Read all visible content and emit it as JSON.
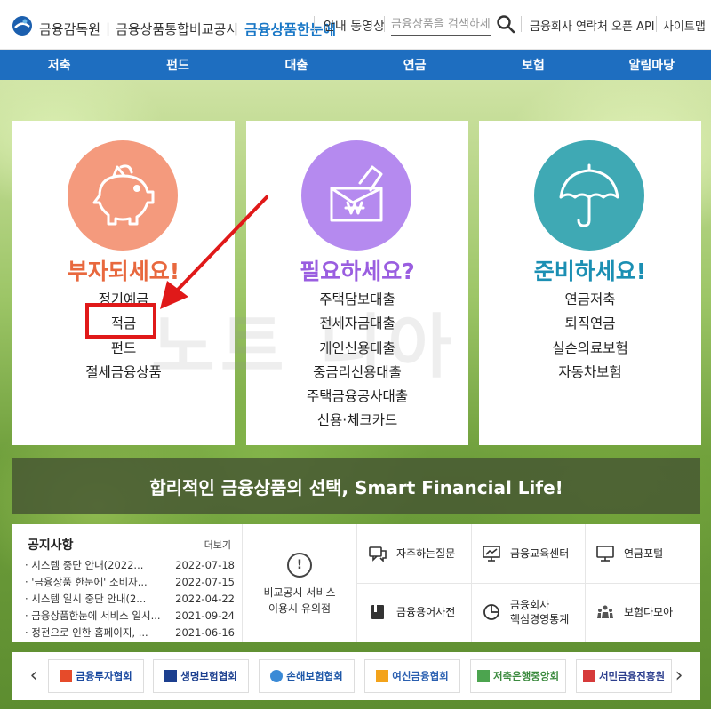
{
  "header": {
    "org": "금융감독원",
    "service": "금융상품통합비교공시",
    "brand": "금융상품한눈에",
    "video_link": "안내 동영상",
    "search_placeholder": "금융상품을 검색하세요",
    "links": [
      "금융회사 연락처",
      "오픈 API",
      "사이트맵"
    ]
  },
  "nav": [
    "저축",
    "펀드",
    "대출",
    "연금",
    "보험",
    "알림마당"
  ],
  "cards": [
    {
      "title": "부자되세요!",
      "color": "#e8683e",
      "circle_color": "#f49a7d",
      "icon": "piggy-bank-icon",
      "items": [
        "정기예금",
        "적금",
        "펀드",
        "절세금융상품"
      ]
    },
    {
      "title": "필요하세요?",
      "color": "#9a5ee0",
      "circle_color": "#b58aef",
      "icon": "won-envelope-icon",
      "items": [
        "주택담보대출",
        "전세자금대출",
        "개인신용대출",
        "중금리신용대출",
        "주택금융공사대출",
        "신용·체크카드"
      ]
    },
    {
      "title": "준비하세요!",
      "color": "#1b8fb3",
      "circle_color": "#3fa9b4",
      "icon": "umbrella-icon",
      "items": [
        "연금저축",
        "퇴직연금",
        "실손의료보험",
        "자동차보험"
      ]
    }
  ],
  "watermark": "노트 니아",
  "banner": "합리적인 금융상품의 선택, Smart Financial Life!",
  "notice": {
    "title": "공지사항",
    "more": "더보기",
    "items": [
      {
        "text": "· 시스템 중단 안내(2022...",
        "date": "2022-07-18"
      },
      {
        "text": "· '금융상품 한눈에' 소비자...",
        "date": "2022-07-15"
      },
      {
        "text": "· 시스템 일시 중단 안내(2...",
        "date": "2022-04-22"
      },
      {
        "text": "· 금융상품한눈에 서비스 일시...",
        "date": "2021-09-24"
      },
      {
        "text": "· 정전으로 인한 홈페이지, ...",
        "date": "2021-06-16"
      }
    ]
  },
  "caution": {
    "line1": "비교공시 서비스",
    "line2": "이용시 유의점"
  },
  "quick_links": [
    {
      "label": "자주하는질문",
      "icon": "chat-icon"
    },
    {
      "label": "금융교육센터",
      "icon": "presentation-icon"
    },
    {
      "label": "연금포털",
      "icon": "monitor-icon"
    },
    {
      "label": "금융용어사전",
      "icon": "book-icon"
    },
    {
      "label": "금융회사\n핵심경영통계",
      "icon": "pie-chart-icon"
    },
    {
      "label": "보험다모아",
      "icon": "people-icon"
    }
  ],
  "partners": [
    {
      "name": "금융투자협회",
      "color": "#1b4aa0"
    },
    {
      "name": "생명보험협회",
      "color": "#1c3f8f"
    },
    {
      "name": "손해보험협회",
      "color": "#1d57a8"
    },
    {
      "name": "여신금융협회",
      "color": "#2a5fb0"
    },
    {
      "name": "저축은행중앙회",
      "color": "#3b8a3e"
    },
    {
      "name": "서민금융진흥원",
      "color": "#2d3f8e"
    }
  ]
}
